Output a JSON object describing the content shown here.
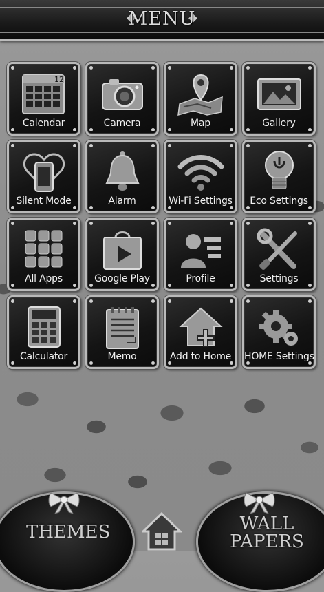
{
  "header": {
    "title": "MENU"
  },
  "tiles": [
    {
      "label": "Calendar",
      "icon": "calendar-icon",
      "badge": "12"
    },
    {
      "label": "Camera",
      "icon": "camera-icon"
    },
    {
      "label": "Map",
      "icon": "map-icon"
    },
    {
      "label": "Gallery",
      "icon": "gallery-icon"
    },
    {
      "label": "Silent Mode",
      "icon": "silent-mode-icon"
    },
    {
      "label": "Alarm",
      "icon": "bell-icon"
    },
    {
      "label": "Wi-Fi Settings",
      "icon": "wifi-icon"
    },
    {
      "label": "Eco Settings",
      "icon": "lightbulb-icon"
    },
    {
      "label": "All Apps",
      "icon": "app-grid-icon"
    },
    {
      "label": "Google Play",
      "icon": "play-bag-icon"
    },
    {
      "label": "Profile",
      "icon": "profile-icon"
    },
    {
      "label": "Settings",
      "icon": "tools-icon"
    },
    {
      "label": "Calculator",
      "icon": "calculator-icon"
    },
    {
      "label": "Memo",
      "icon": "notepad-icon"
    },
    {
      "label": "Add to Home",
      "icon": "add-home-icon"
    },
    {
      "label": "HOME Settings",
      "icon": "gears-icon"
    }
  ],
  "dock": {
    "themes_label": "THEMES",
    "wallpapers_line1": "WALL",
    "wallpapers_line2": "PAPERS"
  },
  "colors": {
    "accent": "#bdbdbd",
    "tile_bg": "#141414",
    "text": "#f0f0f0"
  }
}
